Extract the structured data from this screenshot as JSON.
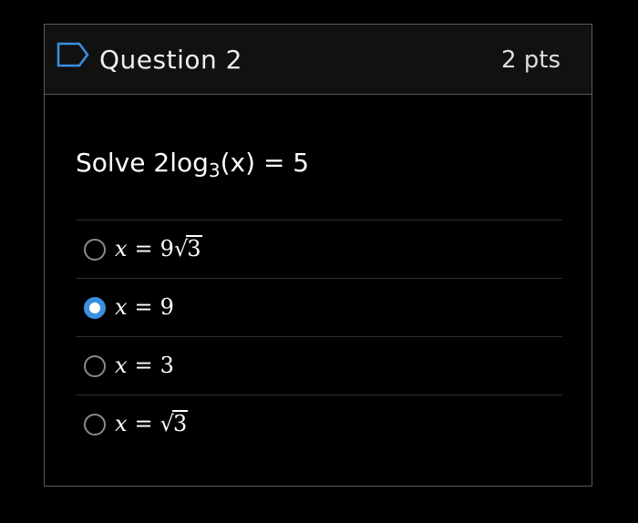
{
  "question": {
    "title": "Question 2",
    "points": "2 pts",
    "prompt_prefix": "Solve 2log",
    "prompt_base": "3",
    "prompt_suffix": "(x) = 5"
  },
  "answers": [
    {
      "var": "x",
      "eq": "=",
      "coef": "9",
      "radicand": "3",
      "selected": false
    },
    {
      "var": "x",
      "eq": "=",
      "value": "9",
      "selected": true
    },
    {
      "var": "x",
      "eq": "=",
      "value": "3",
      "selected": false
    },
    {
      "var": "x",
      "eq": "=",
      "radicand": "3",
      "selected": false
    }
  ],
  "colors": {
    "background": "#000000",
    "header_background": "#111111",
    "border": "#5a5a5a",
    "selected_radio": "#3c8fe0",
    "flag_icon": "#3c8fe0"
  },
  "icons": {
    "question_flag": "flag-outline-icon",
    "radio": "radio-button"
  }
}
